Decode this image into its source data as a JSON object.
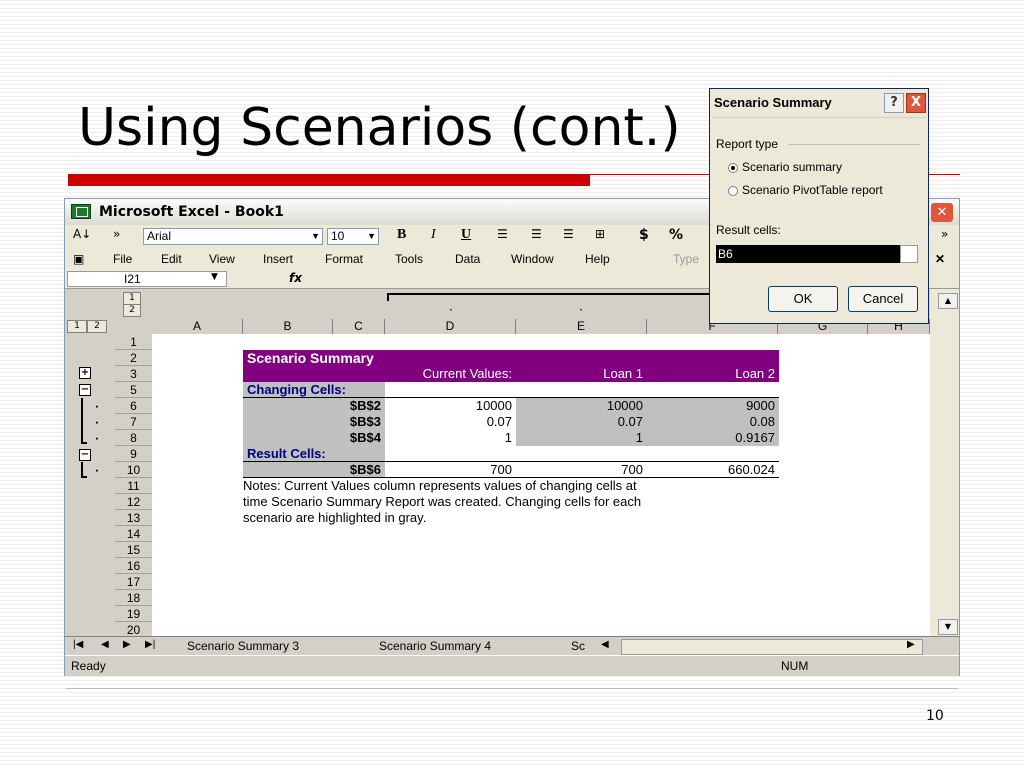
{
  "slide": {
    "title": "Using Scenarios (cont.)",
    "page_number": "10"
  },
  "excel": {
    "title": "Microsoft Excel - Book1",
    "toolbar": {
      "font_name": "Arial",
      "font_size": "10",
      "bold": "B",
      "italic": "I",
      "underline": "U",
      "currency": "$",
      "percent": "%"
    },
    "menu": [
      "File",
      "Edit",
      "View",
      "Insert",
      "Format",
      "Tools",
      "Data",
      "Window",
      "Help"
    ],
    "help_box_placeholder": "Type",
    "name_box": "I21",
    "fx_label": "fx",
    "outline_levels_top": [
      "1",
      "2"
    ],
    "outline_levels_left": [
      "1",
      "2"
    ],
    "columns": [
      "A",
      "B",
      "C",
      "D",
      "E",
      "F",
      "G",
      "H"
    ],
    "rows": [
      "1",
      "2",
      "3",
      "5",
      "6",
      "7",
      "8",
      "9",
      "10",
      "11",
      "12",
      "13",
      "14",
      "15",
      "16",
      "17",
      "18",
      "19",
      "20"
    ],
    "summary": {
      "title": "Scenario Summary",
      "headers": [
        "Current Values:",
        "Loan 1",
        "Loan 2"
      ],
      "changing_label": "Changing Cells:",
      "changing_rows": [
        {
          "cell": "$B$2",
          "current": "10000",
          "loan1": "10000",
          "loan2": "9000"
        },
        {
          "cell": "$B$3",
          "current": "0.07",
          "loan1": "0.07",
          "loan2": "0.08"
        },
        {
          "cell": "$B$4",
          "current": "1",
          "loan1": "1",
          "loan2": "0.9167"
        }
      ],
      "result_label": "Result Cells:",
      "result_row": {
        "cell": "$B$6",
        "current": "700",
        "loan1": "700",
        "loan2": "660.024"
      },
      "notes": [
        "Notes:  Current Values column represents values of changing cells at",
        "time Scenario Summary Report was created.  Changing cells for each",
        "scenario are highlighted in gray."
      ]
    },
    "sheet_tabs": [
      "Scenario Summary 3",
      "Scenario Summary 4",
      "Sc"
    ],
    "status": {
      "left": "Ready",
      "num": "NUM"
    }
  },
  "dialog": {
    "title": "Scenario Summary",
    "help": "?",
    "close": "X",
    "report_type_label": "Report type",
    "options": [
      {
        "label": "Scenario summary",
        "selected": true
      },
      {
        "label": "Scenario PivotTable report",
        "selected": false
      }
    ],
    "result_cells_label": "Result cells:",
    "result_cells_value": "B6",
    "ok": "OK",
    "cancel": "Cancel"
  }
}
